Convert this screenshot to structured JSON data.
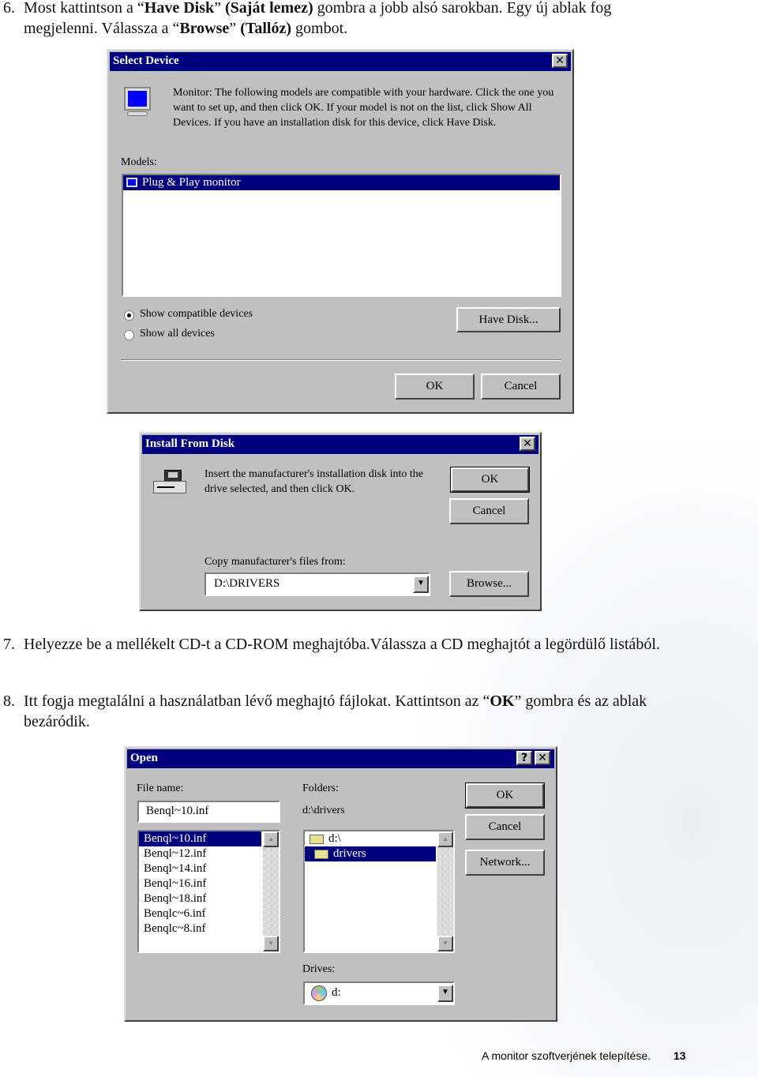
{
  "steps": [
    {
      "num": "6.",
      "text_parts": [
        "Most kattintson a  “",
        "Have Disk",
        "” ",
        "(Saját lemez)",
        " gombra a jobb alsó sarokban. Egy új ablak fog megjelenni. Válassza a  “",
        "Browse",
        "” ",
        "(Tallóz)",
        " gombot."
      ]
    },
    {
      "num": "7.",
      "text": "Helyezze be a mellékelt CD-t a CD-ROM meghajtóba.Válassza a CD meghajtót a legördülő listából."
    },
    {
      "num": "8.",
      "text_parts": [
        " Itt fogja megtalálni a használatban lévő meghajtó fájlokat. Kattintson az “",
        "OK",
        "” gombra és az ablak bezáródik."
      ]
    }
  ],
  "select_device": {
    "title": "Select Device",
    "message": "Monitor: The following models are compatible with your hardware. Click the one you want to set up, and then click OK. If your model is not on the list, click Show All Devices. If you have an installation disk for this device, click Have Disk.",
    "models_label": "Models:",
    "models": [
      "Plug & Play monitor"
    ],
    "radio_compatible": "Show compatible devices",
    "radio_all": "Show all devices",
    "selected_radio": "compatible",
    "have_disk": "Have Disk...",
    "ok": "OK",
    "cancel": "Cancel"
  },
  "install_from_disk": {
    "title": "Install From Disk",
    "message": "Insert the manufacturer's installation disk into the drive selected, and then click OK.",
    "ok": "OK",
    "cancel": "Cancel",
    "copy_label": "Copy manufacturer's files from:",
    "path_value": "D:\\DRIVERS",
    "browse": "Browse..."
  },
  "open_dialog": {
    "title": "Open",
    "help": "?",
    "file_name_label": "File name:",
    "file_name_value": "Benql~10.inf",
    "files": [
      "Benql~10.inf",
      "Benql~12.inf",
      "Benql~14.inf",
      "Benql~16.inf",
      "Benql~18.inf",
      "Benqlc~6.inf",
      "Benqlc~8.inf"
    ],
    "folders_label": "Folders:",
    "current_folder": "d:\\drivers",
    "folders": [
      "d:\\",
      "drivers"
    ],
    "drives_label": "Drives:",
    "drive_value": "d:",
    "ok": "OK",
    "cancel": "Cancel",
    "network": "Network..."
  },
  "footer": {
    "title": "A monitor szoftverjének telepítése.",
    "page": "13"
  },
  "colors": {
    "title_bar": "#00007f",
    "dialog": "#c0c0c0"
  }
}
